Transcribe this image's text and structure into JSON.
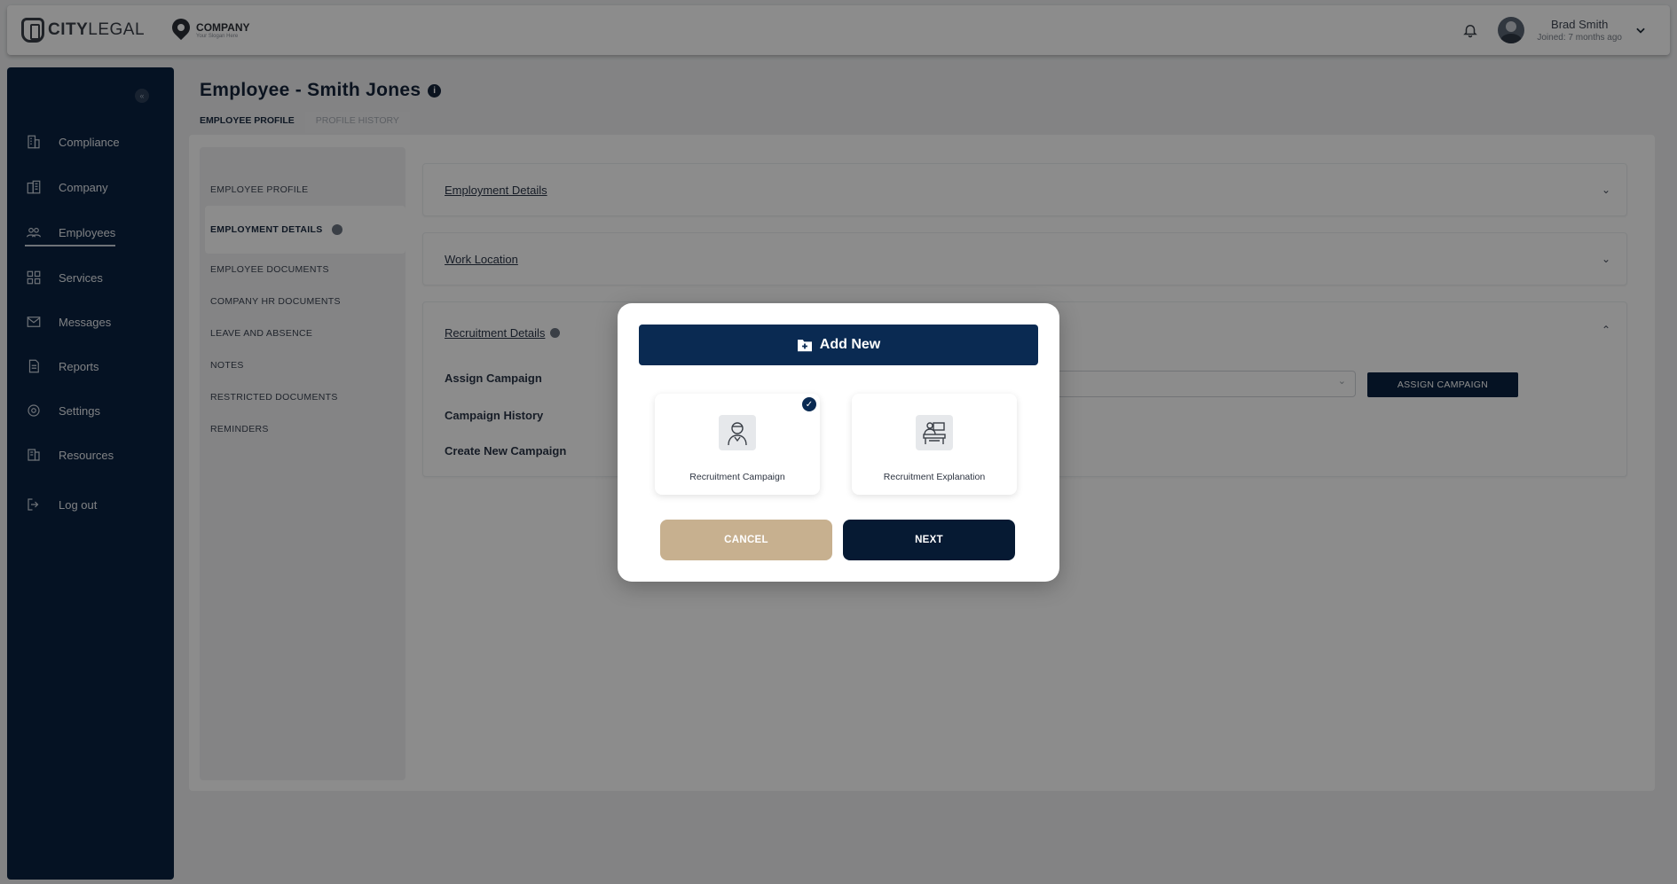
{
  "header": {
    "brand_city": "CITY",
    "brand_legal": "LEGAL",
    "company_name": "COMPANY",
    "company_tagline": "Your Slogan Here",
    "user_name": "Brad Smith",
    "user_joined": "Joined: 7 months ago"
  },
  "sidebar": {
    "items": [
      {
        "label": "Compliance",
        "icon": "building-icon"
      },
      {
        "label": "Company",
        "icon": "office-icon"
      },
      {
        "label": "Employees",
        "icon": "people-icon"
      },
      {
        "label": "Services",
        "icon": "grid-icon"
      },
      {
        "label": "Messages",
        "icon": "envelope-icon"
      },
      {
        "label": "Reports",
        "icon": "report-icon"
      },
      {
        "label": "Settings",
        "icon": "gear-icon"
      },
      {
        "label": "Resources",
        "icon": "resources-icon"
      },
      {
        "label": "Log out",
        "icon": "logout-icon"
      }
    ]
  },
  "page": {
    "title": "Employee - Smith Jones",
    "tabs": [
      "EMPLOYEE PROFILE",
      "PROFILE HISTORY"
    ]
  },
  "subnav": {
    "items": [
      "EMPLOYEE PROFILE",
      "EMPLOYMENT DETAILS",
      "EMPLOYEE DOCUMENTS",
      "COMPANY HR DOCUMENTS",
      "LEAVE AND ABSENCE",
      "NOTES",
      "RESTRICTED DOCUMENTS",
      "REMINDERS"
    ]
  },
  "sections": {
    "employment_details": "Employment Details",
    "work_location": "Work Location",
    "recruitment_details": "Recruitment Details",
    "assign_campaign": "Assign Campaign",
    "campaign_history": "Campaign History",
    "create_new_campaign": "Create New Campaign",
    "assign_button": "ASSIGN CAMPAIGN"
  },
  "modal": {
    "title": "Add New",
    "options": [
      {
        "label": "Recruitment Campaign",
        "selected": true
      },
      {
        "label": "Recruitment Explanation",
        "selected": false
      }
    ],
    "cancel": "CANCEL",
    "next": "NEXT"
  },
  "colors": {
    "navy": "#0a2240",
    "tan": "#c7b08f"
  }
}
